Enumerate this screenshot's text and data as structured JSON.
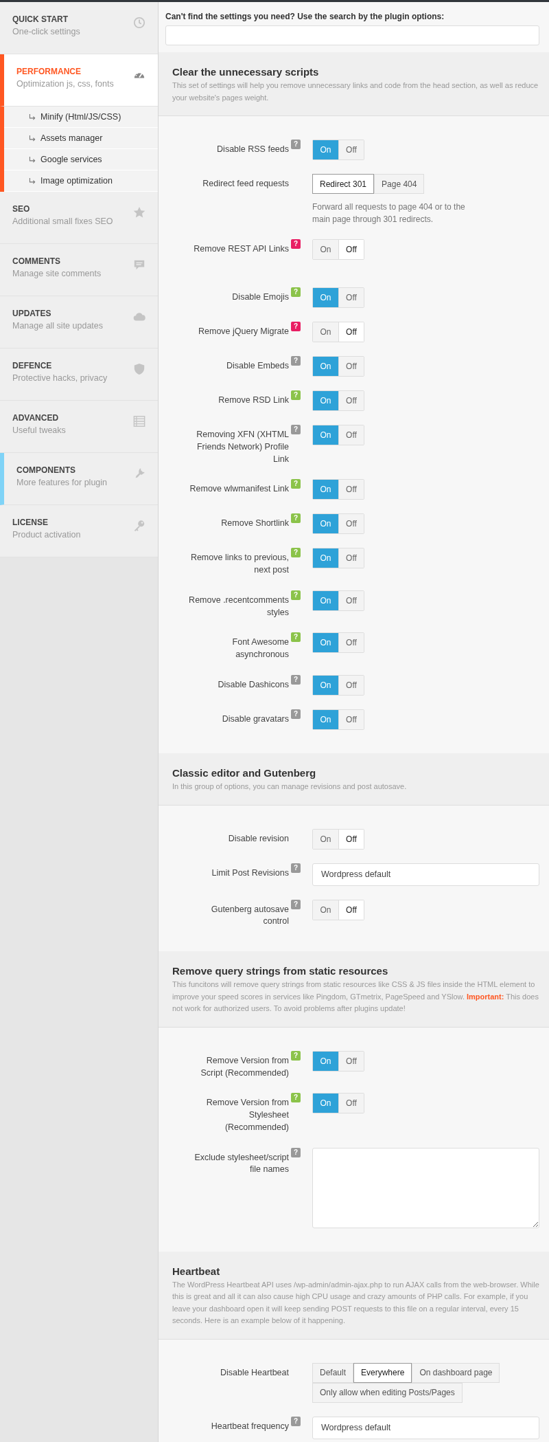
{
  "sidebar": {
    "items": [
      {
        "title": "QUICK START",
        "subtitle": "One-click settings",
        "selected": false,
        "highlighted": false
      },
      {
        "title": "PERFORMANCE",
        "subtitle": "Optimization js, css, fonts",
        "selected": true,
        "highlighted": false,
        "children": [
          {
            "label": "Minify (Html/JS/CSS)"
          },
          {
            "label": "Assets manager"
          },
          {
            "label": "Google services"
          },
          {
            "label": "Image optimization"
          }
        ]
      },
      {
        "title": "SEO",
        "subtitle": "Additional small fixes SEO",
        "selected": false,
        "highlighted": false
      },
      {
        "title": "COMMENTS",
        "subtitle": "Manage site comments",
        "selected": false,
        "highlighted": false
      },
      {
        "title": "UPDATES",
        "subtitle": "Manage all site updates",
        "selected": false,
        "highlighted": false
      },
      {
        "title": "DEFENCE",
        "subtitle": "Protective hacks, privacy",
        "selected": false,
        "highlighted": false
      },
      {
        "title": "ADVANCED",
        "subtitle": "Useful tweaks",
        "selected": false,
        "highlighted": false
      },
      {
        "title": "COMPONENTS",
        "subtitle": "More features for plugin",
        "selected": false,
        "highlighted": true
      },
      {
        "title": "LICENSE",
        "subtitle": "Product activation",
        "selected": false,
        "highlighted": false
      }
    ]
  },
  "search": {
    "label": "Can't find the settings you need? Use the search by the plugin options:"
  },
  "sections": [
    {
      "title": "Clear the unnecessary scripts",
      "description": "This set of settings will help you remove unnecessary links and code from the head section, as well as reduce your website's pages weight.",
      "groups": [
        {
          "rows": [
            {
              "kind": "toggle",
              "label": "Disable RSS feeds",
              "help": {
                "text": "?",
                "color": "#999999"
              },
              "options": [
                {
                  "label": "On",
                  "selected": true
                },
                {
                  "label": "Off",
                  "selected": false
                }
              ]
            },
            {
              "kind": "segmented",
              "label": "Redirect feed requests",
              "options": [
                {
                  "label": "Redirect 301",
                  "selected": true
                },
                {
                  "label": "Page 404",
                  "selected": false
                }
              ],
              "note": "Forward all requests to page 404 or to the main page through 301 redirects."
            },
            {
              "kind": "toggle",
              "label": "Remove REST API Links",
              "help": {
                "text": "?",
                "color": "#e91e63"
              },
              "options": [
                {
                  "label": "On",
                  "selected": false
                },
                {
                  "label": "Off",
                  "selected": true
                }
              ]
            }
          ]
        },
        {
          "rows": [
            {
              "kind": "toggle",
              "label": "Disable Emojis",
              "help": {
                "text": "?",
                "color": "#8bc34a"
              },
              "options": [
                {
                  "label": "On",
                  "selected": true
                },
                {
                  "label": "Off",
                  "selected": false
                }
              ]
            },
            {
              "kind": "toggle",
              "label": "Remove jQuery Migrate",
              "help": {
                "text": "?",
                "color": "#e91e63"
              },
              "options": [
                {
                  "label": "On",
                  "selected": false
                },
                {
                  "label": "Off",
                  "selected": true
                }
              ]
            },
            {
              "kind": "toggle",
              "label": "Disable Embeds",
              "help": {
                "text": "?",
                "color": "#999999"
              },
              "options": [
                {
                  "label": "On",
                  "selected": true
                },
                {
                  "label": "Off",
                  "selected": false
                }
              ]
            },
            {
              "kind": "toggle",
              "label": "Remove RSD Link",
              "help": {
                "text": "?",
                "color": "#8bc34a"
              },
              "options": [
                {
                  "label": "On",
                  "selected": true
                },
                {
                  "label": "Off",
                  "selected": false
                }
              ]
            },
            {
              "kind": "toggle",
              "label": "Removing XFN (XHTML Friends Network) Profile Link",
              "help": {
                "text": "?",
                "color": "#999999"
              },
              "options": [
                {
                  "label": "On",
                  "selected": true
                },
                {
                  "label": "Off",
                  "selected": false
                }
              ]
            },
            {
              "kind": "toggle",
              "label": "Remove wlwmanifest Link",
              "help": {
                "text": "?",
                "color": "#8bc34a"
              },
              "options": [
                {
                  "label": "On",
                  "selected": true
                },
                {
                  "label": "Off",
                  "selected": false
                }
              ]
            },
            {
              "kind": "toggle",
              "label": "Remove Shortlink",
              "help": {
                "text": "?",
                "color": "#8bc34a"
              },
              "options": [
                {
                  "label": "On",
                  "selected": true
                },
                {
                  "label": "Off",
                  "selected": false
                }
              ]
            },
            {
              "kind": "toggle",
              "label": "Remove links to previous, next post",
              "help": {
                "text": "?",
                "color": "#8bc34a"
              },
              "options": [
                {
                  "label": "On",
                  "selected": true
                },
                {
                  "label": "Off",
                  "selected": false
                }
              ]
            },
            {
              "kind": "toggle",
              "label": "Remove .recentcomments styles",
              "help": {
                "text": "?",
                "color": "#8bc34a"
              },
              "options": [
                {
                  "label": "On",
                  "selected": true
                },
                {
                  "label": "Off",
                  "selected": false
                }
              ]
            },
            {
              "kind": "toggle",
              "label": "Font Awesome asynchronous",
              "help": {
                "text": "?",
                "color": "#8bc34a"
              },
              "options": [
                {
                  "label": "On",
                  "selected": true
                },
                {
                  "label": "Off",
                  "selected": false
                }
              ]
            },
            {
              "kind": "toggle",
              "label": "Disable Dashicons",
              "help": {
                "text": "?",
                "color": "#999999"
              },
              "options": [
                {
                  "label": "On",
                  "selected": true
                },
                {
                  "label": "Off",
                  "selected": false
                }
              ]
            },
            {
              "kind": "toggle",
              "label": "Disable gravatars",
              "help": {
                "text": "?",
                "color": "#999999"
              },
              "options": [
                {
                  "label": "On",
                  "selected": true
                },
                {
                  "label": "Off",
                  "selected": false
                }
              ]
            }
          ]
        }
      ]
    },
    {
      "title": "Classic editor and Gutenberg",
      "description": "In this group of options, you can manage revisions and post autosave.",
      "groups": [
        {
          "rows": [
            {
              "kind": "toggle",
              "label": "Disable revision",
              "options": [
                {
                  "label": "On",
                  "selected": false
                },
                {
                  "label": "Off",
                  "selected": true
                }
              ]
            },
            {
              "kind": "input",
              "label": "Limit Post Revisions",
              "help": {
                "text": "?",
                "color": "#999999"
              },
              "value": "Wordpress default"
            },
            {
              "kind": "toggle",
              "label": "Gutenberg autosave control",
              "help": {
                "text": "?",
                "color": "#999999"
              },
              "options": [
                {
                  "label": "On",
                  "selected": false
                },
                {
                  "label": "Off",
                  "selected": true
                }
              ]
            }
          ]
        }
      ]
    },
    {
      "title": "Remove query strings from static resources",
      "description": "This funcitons will remove query strings from static resources like CSS & JS files inside the HTML element to improve your speed scores in services like Pingdom, GTmetrix, PageSpeed and YSlow. **Important:** This does not work for authorized users. To avoid problems after plugins update!",
      "groups": [
        {
          "rows": [
            {
              "kind": "toggle",
              "label": "Remove Version from Script (Recommended)",
              "help": {
                "text": "?",
                "color": "#8bc34a"
              },
              "options": [
                {
                  "label": "On",
                  "selected": true
                },
                {
                  "label": "Off",
                  "selected": false
                }
              ]
            },
            {
              "kind": "toggle",
              "label": "Remove Version from Stylesheet (Recommended)",
              "help": {
                "text": "?",
                "color": "#8bc34a"
              },
              "options": [
                {
                  "label": "On",
                  "selected": true
                },
                {
                  "label": "Off",
                  "selected": false
                }
              ]
            },
            {
              "kind": "textarea",
              "label": "Exclude stylesheet/script file names",
              "help": {
                "text": "?",
                "color": "#999999"
              }
            }
          ]
        }
      ]
    },
    {
      "title": "Heartbeat",
      "description": "The WordPress Heartbeat API uses /wp-admin/admin-ajax.php to run AJAX calls from the web-browser. While this is great and all it can also cause high CPU usage and crazy amounts of PHP calls. For example, if you leave your dashboard open it will keep sending POST requests to this file on a regular interval, every 15 seconds. Here is an example below of it happening.",
      "groups": [
        {
          "rows": [
            {
              "kind": "segmented",
              "label": "Disable Heartbeat",
              "options": [
                {
                  "label": "Default",
                  "selected": false
                },
                {
                  "label": "Everywhere",
                  "selected": true
                },
                {
                  "label": "On dashboard page",
                  "selected": false
                },
                {
                  "label": "Only allow when editing Posts/Pages",
                  "selected": false
                }
              ]
            },
            {
              "kind": "input",
              "label": "Heartbeat frequency",
              "help": {
                "text": "?",
                "color": "#999999"
              },
              "value": "Wordpress default"
            }
          ]
        }
      ]
    }
  ]
}
